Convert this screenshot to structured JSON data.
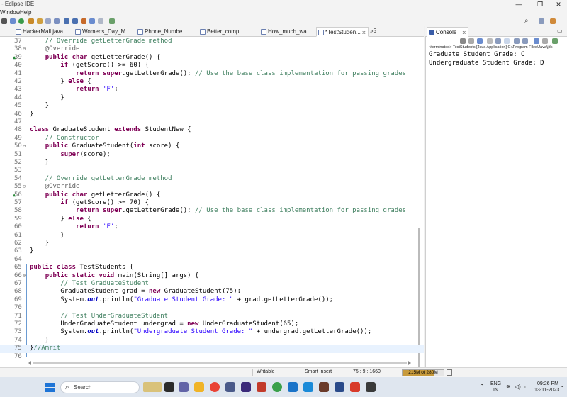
{
  "window": {
    "title": "- Eclipse IDE",
    "controls": [
      "—",
      "❐",
      "✕"
    ]
  },
  "menu": [
    "Window",
    "Help"
  ],
  "editor_tabs": [
    {
      "label": "HackerMall.java",
      "active": false
    },
    {
      "label": "Womens_Day_M...",
      "active": false
    },
    {
      "label": "Phone_Numbe...",
      "active": false
    },
    {
      "label": "Better_comp...",
      "active": false
    },
    {
      "label": "How_much_wa...",
      "active": false
    },
    {
      "label": "*TestStuden...",
      "active": true
    }
  ],
  "overflow_tabs": "»5",
  "code_lines": [
    {
      "n": "37",
      "m": "",
      "t": [
        [
          "cm",
          "    // Override getLetterGrade method"
        ]
      ]
    },
    {
      "n": "38",
      "m": "⊖",
      "t": [
        [
          "an",
          "    @Override"
        ]
      ]
    },
    {
      "n": "39",
      "m": "▲",
      "t": [
        [
          "p",
          "    "
        ],
        [
          "kw",
          "public char"
        ],
        [
          "p",
          " getLetterGrade() {"
        ]
      ]
    },
    {
      "n": "40",
      "m": "",
      "t": [
        [
          "p",
          "        "
        ],
        [
          "kw",
          "if"
        ],
        [
          "p",
          " (getScore() >= 60) {"
        ]
      ]
    },
    {
      "n": "41",
      "m": "",
      "t": [
        [
          "p",
          "            "
        ],
        [
          "kw",
          "return super"
        ],
        [
          "p",
          ".getLetterGrade(); "
        ],
        [
          "cm",
          "// Use the base class implementation for passing grades"
        ]
      ]
    },
    {
      "n": "42",
      "m": "",
      "t": [
        [
          "p",
          "        } "
        ],
        [
          "kw",
          "else"
        ],
        [
          "p",
          " {"
        ]
      ]
    },
    {
      "n": "43",
      "m": "",
      "t": [
        [
          "p",
          "            "
        ],
        [
          "kw",
          "return"
        ],
        [
          "p",
          " "
        ],
        [
          "st",
          "'F'"
        ],
        [
          "p",
          ";"
        ]
      ]
    },
    {
      "n": "44",
      "m": "",
      "t": [
        [
          "p",
          "        }"
        ]
      ]
    },
    {
      "n": "45",
      "m": "",
      "t": [
        [
          "p",
          "    }"
        ]
      ]
    },
    {
      "n": "46",
      "m": "",
      "t": [
        [
          "p",
          "}"
        ]
      ]
    },
    {
      "n": "47",
      "m": "",
      "t": [
        [
          "p",
          ""
        ]
      ]
    },
    {
      "n": "48",
      "m": "",
      "t": [
        [
          "kw",
          "class"
        ],
        [
          "p",
          " GraduateStudent "
        ],
        [
          "kw",
          "extends"
        ],
        [
          "p",
          " StudentNew {"
        ]
      ]
    },
    {
      "n": "49",
      "m": "",
      "t": [
        [
          "cm",
          "    // Constructor"
        ]
      ]
    },
    {
      "n": "50",
      "m": "⊖",
      "t": [
        [
          "p",
          "    "
        ],
        [
          "kw",
          "public"
        ],
        [
          "p",
          " GraduateStudent("
        ],
        [
          "kw",
          "int"
        ],
        [
          "p",
          " score) {"
        ]
      ]
    },
    {
      "n": "51",
      "m": "",
      "t": [
        [
          "p",
          "        "
        ],
        [
          "kw",
          "super"
        ],
        [
          "p",
          "(score);"
        ]
      ]
    },
    {
      "n": "52",
      "m": "",
      "t": [
        [
          "p",
          "    }"
        ]
      ]
    },
    {
      "n": "53",
      "m": "",
      "t": [
        [
          "p",
          ""
        ]
      ]
    },
    {
      "n": "54",
      "m": "",
      "t": [
        [
          "cm",
          "    // Override getLetterGrade method"
        ]
      ]
    },
    {
      "n": "55",
      "m": "⊖",
      "t": [
        [
          "an",
          "    @Override"
        ]
      ]
    },
    {
      "n": "56",
      "m": "▲",
      "t": [
        [
          "p",
          "    "
        ],
        [
          "kw",
          "public char"
        ],
        [
          "p",
          " getLetterGrade() {"
        ]
      ]
    },
    {
      "n": "57",
      "m": "",
      "t": [
        [
          "p",
          "        "
        ],
        [
          "kw",
          "if"
        ],
        [
          "p",
          " (getScore() >= 70) {"
        ]
      ]
    },
    {
      "n": "58",
      "m": "",
      "t": [
        [
          "p",
          "            "
        ],
        [
          "kw",
          "return super"
        ],
        [
          "p",
          ".getLetterGrade(); "
        ],
        [
          "cm",
          "// Use the base class implementation for passing grades"
        ]
      ]
    },
    {
      "n": "59",
      "m": "",
      "t": [
        [
          "p",
          "        } "
        ],
        [
          "kw",
          "else"
        ],
        [
          "p",
          " {"
        ]
      ]
    },
    {
      "n": "60",
      "m": "",
      "t": [
        [
          "p",
          "            "
        ],
        [
          "kw",
          "return"
        ],
        [
          "p",
          " "
        ],
        [
          "st",
          "'F'"
        ],
        [
          "p",
          ";"
        ]
      ]
    },
    {
      "n": "61",
      "m": "",
      "t": [
        [
          "p",
          "        }"
        ]
      ]
    },
    {
      "n": "62",
      "m": "",
      "t": [
        [
          "p",
          "    }"
        ]
      ]
    },
    {
      "n": "63",
      "m": "",
      "t": [
        [
          "p",
          "}"
        ]
      ]
    },
    {
      "n": "64",
      "m": "",
      "t": [
        [
          "p",
          ""
        ]
      ]
    },
    {
      "n": "65",
      "m": "",
      "t": [
        [
          "kw",
          "public class"
        ],
        [
          "p",
          " TestStudents {"
        ]
      ]
    },
    {
      "n": "66",
      "m": "⊖",
      "t": [
        [
          "p",
          "    "
        ],
        [
          "kw",
          "public static void"
        ],
        [
          "p",
          " main(String[] args) {"
        ]
      ]
    },
    {
      "n": "67",
      "m": "",
      "t": [
        [
          "cm",
          "        // Test GraduateStudent"
        ]
      ]
    },
    {
      "n": "68",
      "m": "",
      "t": [
        [
          "p",
          "        GraduateStudent grad = "
        ],
        [
          "kw",
          "new"
        ],
        [
          "p",
          " GraduateStudent(75);"
        ]
      ]
    },
    {
      "n": "69",
      "m": "",
      "t": [
        [
          "p",
          "        System."
        ],
        [
          "it",
          "out"
        ],
        [
          "p",
          ".println("
        ],
        [
          "st",
          "\"Graduate Student Grade: \""
        ],
        [
          "p",
          " + grad.getLetterGrade());"
        ]
      ]
    },
    {
      "n": "70",
      "m": "",
      "t": [
        [
          "p",
          ""
        ]
      ]
    },
    {
      "n": "71",
      "m": "",
      "t": [
        [
          "cm",
          "        // Test UnderGraduateStudent"
        ]
      ]
    },
    {
      "n": "72",
      "m": "",
      "t": [
        [
          "p",
          "        UnderGraduateStudent undergrad = "
        ],
        [
          "kw",
          "new"
        ],
        [
          "p",
          " UnderGraduateStudent(65);"
        ]
      ]
    },
    {
      "n": "73",
      "m": "",
      "t": [
        [
          "p",
          "        System."
        ],
        [
          "it",
          "out"
        ],
        [
          "p",
          ".println("
        ],
        [
          "st",
          "\"Undergraduate Student Grade: \""
        ],
        [
          "p",
          " + undergrad.getLetterGrade());"
        ]
      ]
    },
    {
      "n": "74",
      "m": "",
      "t": [
        [
          "p",
          "    }"
        ]
      ]
    },
    {
      "n": "75",
      "m": "",
      "t": [
        [
          "p",
          "}"
        ],
        [
          "cm",
          "//Amrit"
        ]
      ]
    },
    {
      "n": "76",
      "m": "",
      "t": [
        [
          "p",
          ""
        ]
      ]
    }
  ],
  "console": {
    "tab_label": "Console",
    "terminated": "<terminated> TestStudents [Java Application] C:\\Program Files\\Java\\jdk",
    "output": [
      "Graduate Student Grade: C",
      "Undergraduate Student Grade: D"
    ]
  },
  "status": {
    "writable": "Writable",
    "insert_mode": "Smart Insert",
    "position": "75 : 9 : 1660",
    "heap": "215M of 280M",
    "heap_fraction": 0.77
  },
  "taskbar": {
    "search_placeholder": "Search",
    "language": "ENG",
    "region": "IN",
    "time": "09:26 PM",
    "date": "13-11-2023"
  },
  "colors": {
    "keyword": "#7f0055",
    "comment": "#3f7f5f",
    "string": "#2a00ff",
    "annotation": "#646464",
    "static_field": "#0000c0",
    "current_line": "#e8f2fe"
  }
}
